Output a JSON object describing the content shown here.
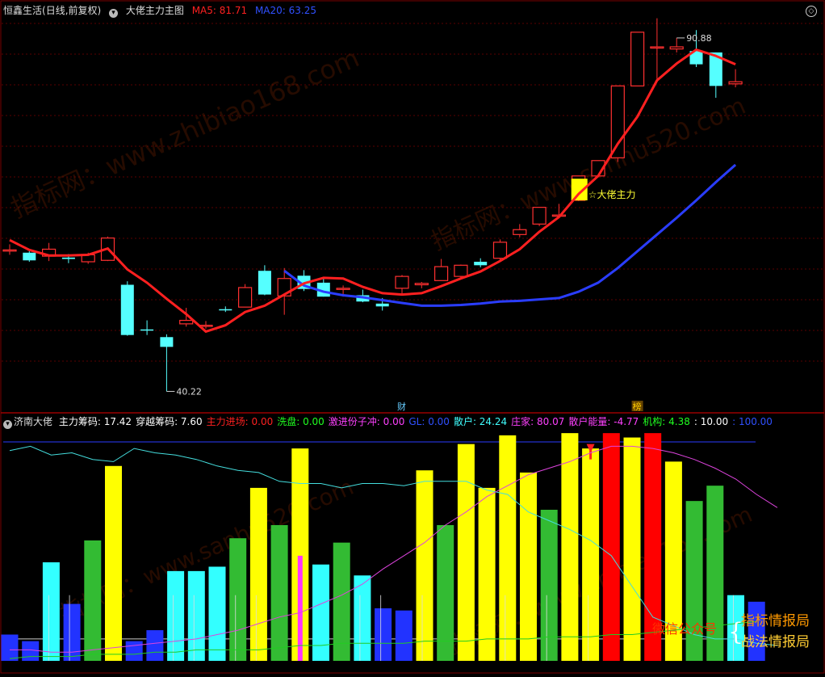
{
  "main_header": {
    "stock": "恒鑫生活",
    "period": "(日线,前复权)",
    "indicator": "大佬主力主图",
    "ma5_label": "MA5: 81.71",
    "ma20_label": "MA20: 63.25",
    "colors": {
      "ma5": "#ff2020",
      "ma20": "#2a3dff",
      "up": "#ff3030",
      "down": "#55ffff"
    }
  },
  "sub_header": {
    "name": "济南大佬",
    "items": [
      {
        "label": "主力筹码: 17.42",
        "color": "#ffffff"
      },
      {
        "label": "穿越筹码: 7.60",
        "color": "#ffffff"
      },
      {
        "label": "主力进场: 0.00",
        "color": "#ff2020"
      },
      {
        "label": "洗盘: 0.00",
        "color": "#20ff20"
      },
      {
        "label": "激进份子冲: 0.00",
        "color": "#ff40ff"
      },
      {
        "label": "GL: 0.00",
        "color": "#3050ff"
      },
      {
        "label": "散户: 24.24",
        "color": "#40ffff"
      },
      {
        "label": "庄家: 80.07",
        "color": "#ff40ff"
      },
      {
        "label": "散户能量: -4.77",
        "color": "#ff40ff"
      },
      {
        "label": "机构: 4.38",
        "color": "#20ff20"
      },
      {
        "label": ": 10.00",
        "color": "#ffffff"
      },
      {
        "label": ": 100.00",
        "color": "#3050ff"
      }
    ]
  },
  "annotations": {
    "high_label": "90.88",
    "low_label": "40.22",
    "signal_label": "☆大佬主力",
    "event_cai": "财",
    "event_bang": "榜"
  },
  "watermarks": [
    "指标网：www.zhibiao168.com",
    "指标网：www.sanhu520.com"
  ],
  "brand": {
    "wechat": "微信公众号",
    "line1": "指标情报局",
    "line2": "战法情报局"
  },
  "chart_data": [
    {
      "type": "candlestick",
      "title": "大佬主力主图",
      "series_names": [
        "MA5",
        "MA20"
      ],
      "ohlc": [
        [
          60.5,
          61.3,
          59.8,
          60.5
        ],
        [
          60.1,
          60.3,
          58.8,
          59.0
        ],
        [
          59.6,
          61.5,
          58.9,
          60.6
        ],
        [
          59.4,
          59.9,
          58.6,
          59.2
        ],
        [
          58.8,
          60.1,
          58.5,
          59.8
        ],
        [
          59.0,
          62.4,
          58.9,
          62.2
        ],
        [
          55.5,
          56.0,
          48.2,
          48.3
        ],
        [
          49.1,
          50.4,
          48.3,
          49.0
        ],
        [
          48.0,
          48.4,
          40.22,
          46.6
        ],
        [
          49.9,
          52.2,
          49.5,
          50.4
        ],
        [
          49.7,
          50.3,
          49.2,
          49.7
        ],
        [
          52.0,
          52.4,
          51.6,
          51.9
        ],
        [
          52.3,
          55.6,
          52.3,
          55.1
        ],
        [
          57.5,
          58.3,
          54.0,
          54.1
        ],
        [
          53.9,
          57.9,
          51.2,
          56.4
        ],
        [
          56.8,
          57.6,
          54.6,
          54.9
        ],
        [
          55.8,
          56.6,
          53.8,
          53.8
        ],
        [
          55.0,
          55.4,
          53.8,
          55.0
        ],
        [
          54.0,
          54.8,
          53.0,
          53.1
        ],
        [
          52.8,
          53.6,
          51.8,
          52.4
        ],
        [
          55.0,
          56.9,
          54.2,
          56.7
        ],
        [
          55.5,
          55.9,
          55.0,
          55.7
        ],
        [
          56.1,
          59.2,
          56.1,
          58.1
        ],
        [
          56.7,
          58.4,
          56.5,
          58.3
        ],
        [
          58.8,
          59.3,
          58.0,
          58.3
        ],
        [
          59.3,
          62.0,
          58.8,
          61.6
        ],
        [
          62.7,
          64.2,
          62.3,
          63.4
        ],
        [
          64.2,
          66.6,
          63.9,
          66.6
        ],
        [
          65.4,
          67.1,
          65.3,
          65.5
        ],
        [
          67.6,
          71.0,
          67.5,
          71.1
        ],
        [
          71.1,
          73.3,
          71.0,
          73.3
        ],
        [
          73.7,
          84.0,
          73.1,
          84.0
        ],
        [
          84.0,
          91.5,
          84.0,
          91.7
        ],
        [
          89.6,
          93.7,
          84.8,
          89.6
        ],
        [
          89.3,
          90.88,
          88.8,
          89.6
        ],
        [
          89.0,
          92.0,
          86.7,
          87.1
        ],
        [
          88.8,
          88.8,
          82.3,
          84.0
        ],
        [
          84.3,
          86.4,
          83.8,
          84.6
        ]
      ],
      "ma5": [
        61.9,
        60.5,
        59.7,
        59.7,
        59.8,
        60.7,
        57.7,
        55.8,
        53.5,
        51.3,
        48.8,
        49.7,
        51.6,
        52.5,
        54.1,
        55.7,
        56.5,
        56.4,
        55.2,
        54.3,
        54.1,
        54.3,
        55.3,
        56.4,
        57.4,
        58.9,
        60.6,
        63.1,
        65.2,
        68.5,
        71.1,
        75.7,
        79.6,
        84.8,
        87.2,
        89.2,
        88.3,
        87.1
      ],
      "ma20": [
        null,
        null,
        null,
        null,
        null,
        null,
        null,
        null,
        null,
        null,
        null,
        null,
        null,
        null,
        57.5,
        55.4,
        54.5,
        54.0,
        53.7,
        53.3,
        52.9,
        52.5,
        52.5,
        52.6,
        52.8,
        53.1,
        53.2,
        53.4,
        53.6,
        54.5,
        55.8,
        57.9,
        60.3,
        62.7,
        65.1,
        67.6,
        70.2,
        72.7
      ],
      "ylim": [
        39,
        94
      ],
      "events": {
        "cai_index": 20,
        "bang_index": 32,
        "signal_index": 29
      }
    },
    {
      "type": "bar",
      "title": "济南大佬",
      "y_ref": [
        10,
        100
      ],
      "bars": [
        {
          "v": 12,
          "c": "#2233ff"
        },
        {
          "v": 9,
          "c": "#2233ff"
        },
        {
          "v": 45,
          "c": "#33ffff"
        },
        {
          "v": 26,
          "c": "#2233ff"
        },
        {
          "v": 55,
          "c": "#33bb33"
        },
        {
          "v": 89,
          "c": "#ffff00"
        },
        {
          "v": 9,
          "c": "#2233ff"
        },
        {
          "v": 14,
          "c": "#2233ff"
        },
        {
          "v": 41,
          "c": "#33ffff"
        },
        {
          "v": 41,
          "c": "#33ffff"
        },
        {
          "v": 43,
          "c": "#33ffff"
        },
        {
          "v": 56,
          "c": "#33bb33"
        },
        {
          "v": 79,
          "c": "#ffff00"
        },
        {
          "v": 62,
          "c": "#33bb33"
        },
        {
          "v": 97,
          "c": "#ffff00"
        },
        {
          "v": 44,
          "c": "#33ffff"
        },
        {
          "v": 54,
          "c": "#33bb33"
        },
        {
          "v": 39,
          "c": "#33ffff"
        },
        {
          "v": 24,
          "c": "#2233ff"
        },
        {
          "v": 23,
          "c": "#2233ff"
        },
        {
          "v": 87,
          "c": "#ffff00"
        },
        {
          "v": 62,
          "c": "#33bb33"
        },
        {
          "v": 99,
          "c": "#ffff00"
        },
        {
          "v": 79,
          "c": "#ffff00"
        },
        {
          "v": 103,
          "c": "#ffff00"
        },
        {
          "v": 86,
          "c": "#ffff00"
        },
        {
          "v": 69,
          "c": "#33bb33"
        },
        {
          "v": 104,
          "c": "#ffff00"
        },
        {
          "v": 97,
          "c": "#ffff00"
        },
        {
          "v": 104,
          "c": "#ff0000"
        },
        {
          "v": 102,
          "c": "#ffff00"
        },
        {
          "v": 104,
          "c": "#ff0000"
        },
        {
          "v": 91,
          "c": "#ffff00"
        },
        {
          "v": 73,
          "c": "#33bb33"
        },
        {
          "v": 80,
          "c": "#33bb33"
        },
        {
          "v": 30,
          "c": "#33ffff"
        },
        {
          "v": 27,
          "c": "#2233ff"
        }
      ],
      "magenta_bar": {
        "index": 14,
        "v": 48
      },
      "cyan_line": [
        96,
        98,
        94,
        95,
        92,
        91,
        97,
        95,
        94,
        92,
        89,
        87,
        86,
        82,
        81,
        81,
        79,
        81,
        81,
        80,
        82,
        82,
        82,
        78,
        76,
        68,
        64,
        60,
        55,
        48,
        34,
        20,
        16,
        12,
        10,
        10,
        8,
        7
      ],
      "magenta_line": [
        5,
        5,
        4,
        4,
        5,
        6,
        7,
        8,
        9,
        10,
        12,
        14,
        17,
        20,
        22,
        26,
        30,
        35,
        42,
        48,
        54,
        62,
        68,
        75,
        80,
        85,
        88,
        91,
        95,
        98,
        98,
        97,
        95,
        92,
        88,
        83,
        76,
        70
      ],
      "green_line": [
        1,
        2,
        2,
        2,
        3,
        3,
        3,
        4,
        4,
        5,
        5,
        5,
        5,
        6,
        7,
        7,
        8,
        8,
        8,
        8,
        9,
        9,
        9,
        10,
        10,
        10,
        11,
        11,
        11,
        12,
        12,
        13,
        14,
        15,
        16,
        17,
        18
      ]
    }
  ]
}
